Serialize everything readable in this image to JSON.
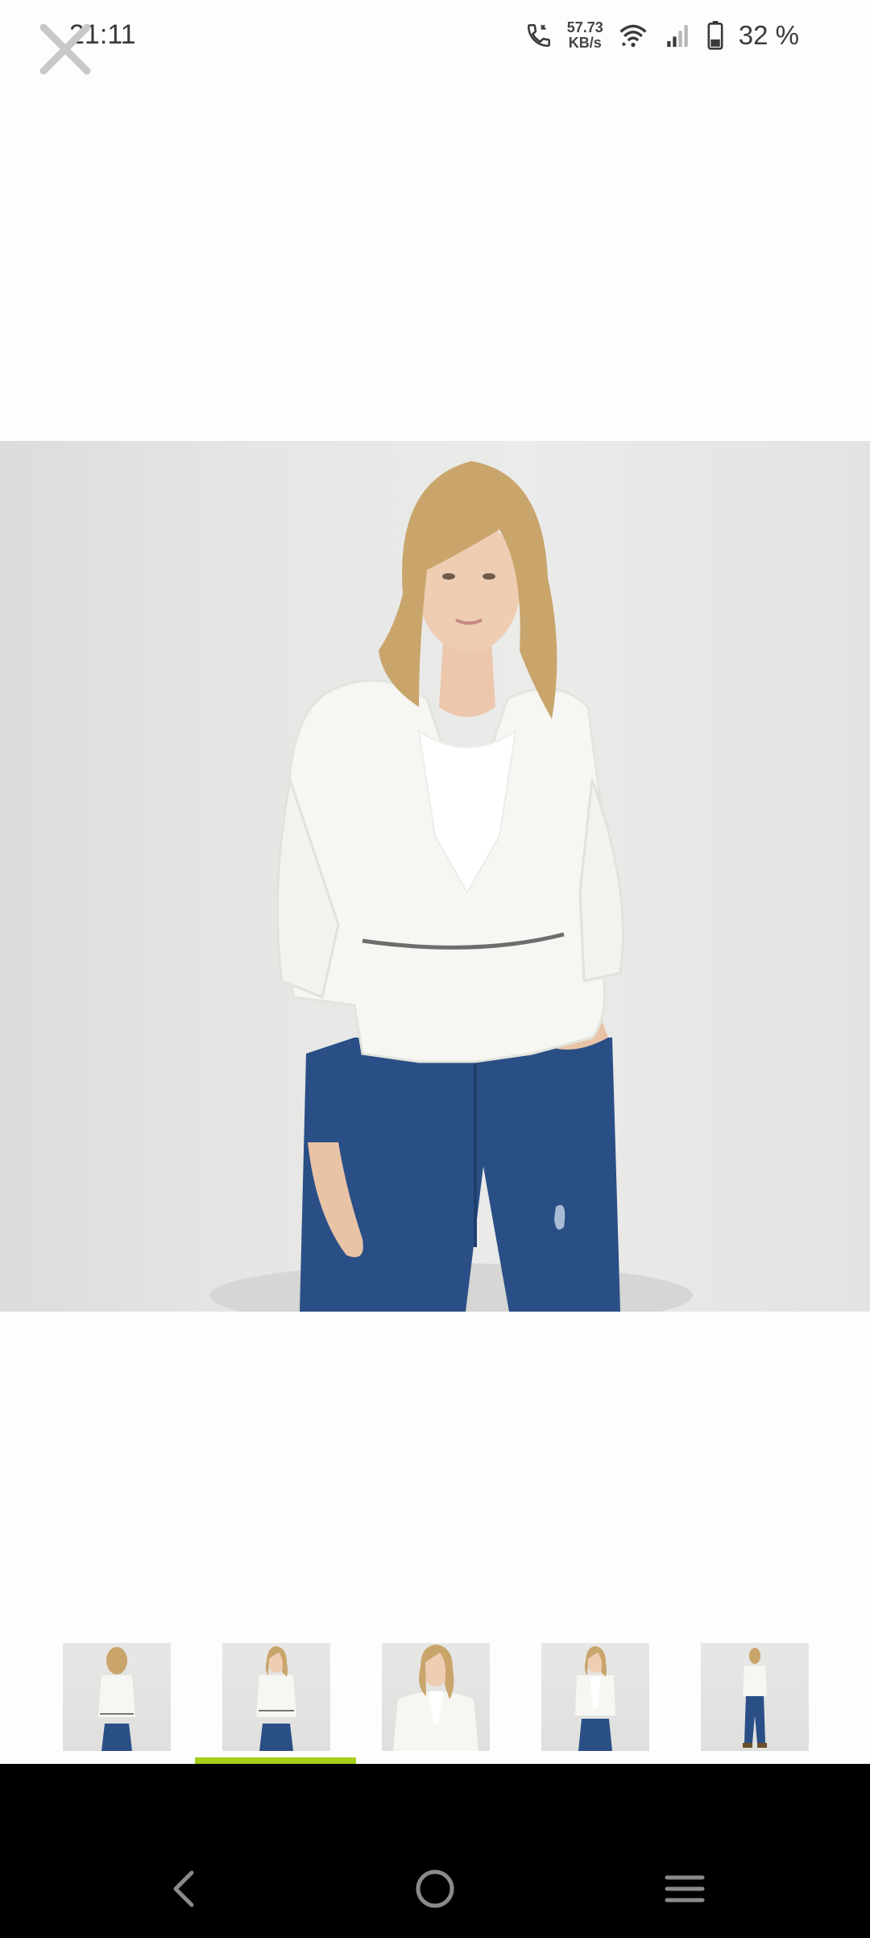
{
  "status_bar": {
    "time": "21:11",
    "net_speed_value": "57.73",
    "net_speed_unit": "KB/s",
    "battery_percent": "32 %"
  },
  "viewer": {
    "close_icon": "close-icon",
    "main_image": "Woman wearing white cropped blazer with zip belt, lace top and blue ripped skinny jeans",
    "selected_thumbnail": 1
  },
  "thumbnails": [
    {
      "view": "back"
    },
    {
      "view": "front"
    },
    {
      "view": "close-up"
    },
    {
      "view": "front-open"
    },
    {
      "view": "full-length"
    }
  ],
  "colors": {
    "indicator": "#a6cf1c",
    "nav_bar": "#000000",
    "background": "#fdfdfd"
  },
  "nav": {
    "back_icon": "back-icon",
    "home_icon": "home-icon",
    "menu_icon": "menu-icon"
  }
}
